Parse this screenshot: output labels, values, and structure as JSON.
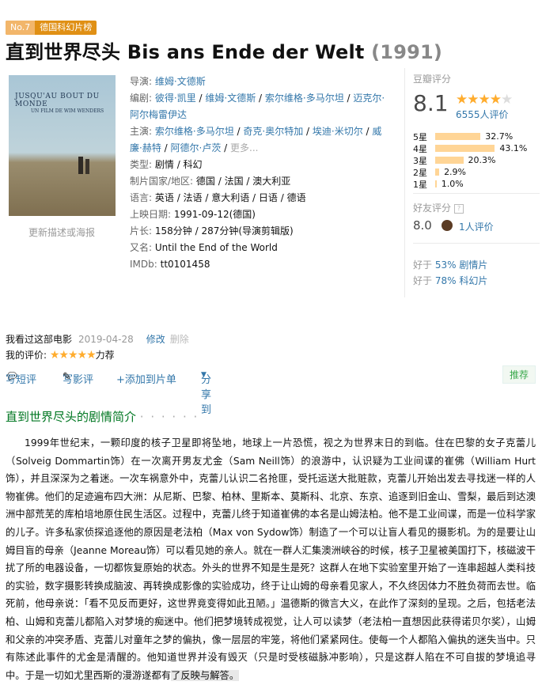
{
  "badge": {
    "no": "No.7",
    "name": "德国科幻片榜"
  },
  "title": {
    "main": "直到世界尽头 Bis ans Ende der Welt",
    "year": "(1991)"
  },
  "poster": {
    "title_text": "JUSQU'AU BOUT DU MONDE",
    "sub_text": "UN FILM DE WIM WENDERS",
    "more_link": "更新描述或海报"
  },
  "info": {
    "director_label": "导演",
    "director": "维姆·文德斯",
    "writer_label": "编剧",
    "writers": [
      "彼得·凯里",
      "维姆·文德斯",
      "索尔维格·多马尔坦",
      "迈克尔·阿尔梅雷伊达"
    ],
    "cast_label": "主演",
    "cast": [
      "索尔维格·多马尔坦",
      "奇克·奥尔特加",
      "埃迪·米切尔",
      "威廉·赫特",
      "阿德尔·卢茨"
    ],
    "cast_more": "更多...",
    "genre_label": "类型",
    "genres": "剧情 / 科幻",
    "country_label": "制片国家/地区",
    "country": "德国 / 法国 / 澳大利亚",
    "language_label": "语言",
    "language": "英语 / 法语 / 意大利语 / 日语 / 德语",
    "release_label": "上映日期",
    "release": "1991-09-12(德国)",
    "runtime_label": "片长",
    "runtime": "158分钟 / 287分钟(导演剪辑版)",
    "aka_label": "又名",
    "aka": "Until the End of the World",
    "imdb_label": "IMDb",
    "imdb": "tt0101458"
  },
  "rating": {
    "title": "豆瓣评分",
    "score": "8.1",
    "stars_filled": 4,
    "count": "6555人评价",
    "bars": [
      {
        "label": "5星",
        "pct": "32.7%",
        "value": 32.7
      },
      {
        "label": "4星",
        "pct": "43.1%",
        "value": 43.1
      },
      {
        "label": "3星",
        "pct": "20.3%",
        "value": 20.3
      },
      {
        "label": "2星",
        "pct": "2.9%",
        "value": 2.9
      },
      {
        "label": "1星",
        "pct": "1.0%",
        "value": 1.0
      }
    ],
    "friend_title": "好友评分",
    "friend_help": "?",
    "friend_score": "8.0",
    "friend_count": "1人评价",
    "better": [
      {
        "prefix": "好于 ",
        "pct": "53%",
        "genre": "剧情片"
      },
      {
        "prefix": "好于 ",
        "pct": "78%",
        "genre": "科幻片"
      }
    ]
  },
  "user": {
    "seen": "我看过这部电影",
    "date": "2019-04-28",
    "edit": "修改",
    "delete": "删除",
    "my_rating_label": "我的评价: ",
    "my_stars": 5,
    "my_rating_text": "力荐"
  },
  "actions": {
    "short_review": "写短评",
    "review": "写影评",
    "add_list": "+添加到片单",
    "share": "分享到",
    "recommend": "推荐"
  },
  "summary": {
    "title": "直到世界尽头的剧情简介",
    "dots": "· · · · · ·",
    "text": "1999年世纪末，一颗印度的核子卫星即将坠地，地球上一片恐慌，视之为世界末日的到临。住在巴黎的女子克蕾儿（Solveig Dommartin饰）在一次离开男友尤金（Sam Neill饰）的浪游中，认识疑为工业间谍的崔佛（William Hurt饰），并且深深为之着迷。一次车祸意外中，克蕾儿认识二名抢匪，受托运送大批赃款，克蕾儿开始出发去寻找迷一样的人物崔佛。他们的足迹遍布四大洲：从尼斯、巴黎、柏林、里斯本、莫斯科、北京、东京、追逐到旧金山、雪梨，最后到达澳洲中部荒芜的库柏培地原住民生活区。过程中，克蕾儿终于知道崔佛的本名是山姆法柏。他不是工业间谍，而是一位科学家的儿子。许多私家侦探追逐他的原因是老法柏（Max von Sydow饰）制造了一个可以让盲人看见的摄影机。为的是要让山姆目盲的母亲（Jeanne Moreau饰）可以看见她的亲人。就在一群人汇集澳洲峡谷的时候，核子卫星被美国打下，核磁波干扰了所的电器设备，一切都恢复原始的状态。外头的世界不知是生是死？这群人在地下实验室里开始了一连串超越人类科技的实验，数字摄影转换成脑波、再转换成影像的实验成功，终于让山姆的母亲看见家人，不久终因体力不胜负荷而去世。临死前，他母亲说：「看不见反而更好，这世界竟变得如此丑陋。」温德斯的微言大义，在此作了深刻的呈现。之后，包括老法柏、山姆和克蕾儿都陷入对梦境的痴迷中。他们把梦境转成视觉，让人可以读梦（老法柏一直想因此获得诺贝尔奖），山姆和父亲的冲突矛盾、克蕾儿对童年之梦的偏执，像一层层的牢笼，将他们紧紧网住。使每一个人都陷入偏执的迷失当中。只有陈述此事件的尤金是清醒的。他知道世界并没有毁灭（只是时受核磁脉冲影响），只是这群人陷在不可自拔的梦境追寻中。于是一切如尤里西斯的漫游遂都有",
    "tail": "了反映与解答。"
  }
}
